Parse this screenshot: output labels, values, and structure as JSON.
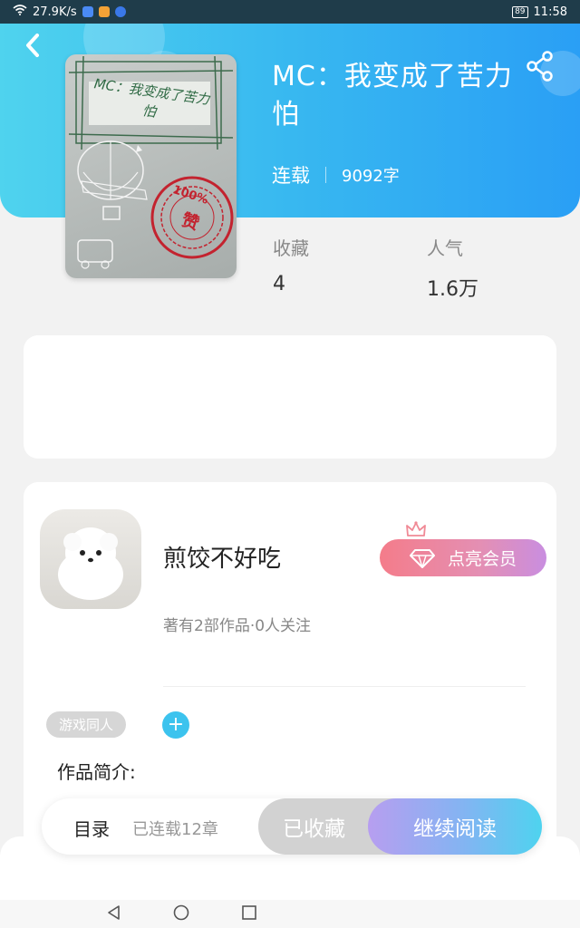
{
  "status_bar": {
    "net_speed": "27.9K/s",
    "battery": "89",
    "time": "11:58"
  },
  "book": {
    "title": "MC：我变成了苦力怕",
    "status": "连载",
    "word_count": "9092字",
    "cover_text": "MC：我变成了苦力怕",
    "stamp_text": "100%",
    "stamp_sub": "赞",
    "stamp_ring": "I love it · I love it · I love it"
  },
  "stats": [
    {
      "label": "收藏",
      "value": "4"
    },
    {
      "label": "人气",
      "value": "1.6万"
    }
  ],
  "author": {
    "name": "煎饺不好吃",
    "summary": "著有2部作品·0人关注",
    "vip_label": "点亮会员"
  },
  "tags": [
    "游戏同人"
  ],
  "add_tag_symbol": "+",
  "intro_label": "作品简介:",
  "action_bar": {
    "toc_label": "目录",
    "toc_sub": "已连载12章",
    "collected_label": "已收藏",
    "read_label": "继续阅读"
  },
  "colors": {
    "header_start": "#4fd3ee",
    "header_end": "#2a9ff5",
    "accent": "#3cc3ee",
    "vip_start": "#f47c8a",
    "vip_end": "#c98ee0"
  },
  "icons": [
    "wifi-icon",
    "back-icon",
    "share-icon",
    "diamond-icon",
    "crown-icon",
    "nav-back-icon",
    "nav-home-icon",
    "nav-recent-icon"
  ]
}
